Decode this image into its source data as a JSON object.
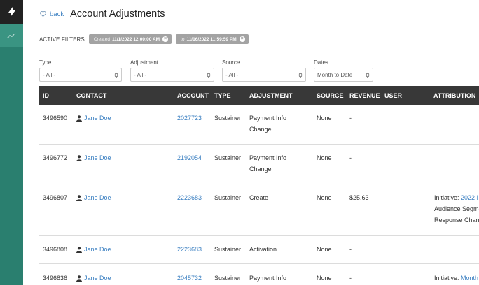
{
  "header": {
    "back_label": "back",
    "title": "Account Adjustments"
  },
  "filters": {
    "label": "ACTIVE FILTERS",
    "chips": [
      {
        "key": "Created",
        "value": "11/1/2022 12:00:00 AM"
      },
      {
        "key": "to",
        "value": "11/16/2022 11:59:59 PM"
      }
    ]
  },
  "selects": {
    "type": {
      "label": "Type",
      "value": "- All -"
    },
    "adjustment": {
      "label": "Adjustment",
      "value": "- All -"
    },
    "source": {
      "label": "Source",
      "value": "- All -"
    },
    "dates": {
      "label": "Dates",
      "value": "Month to Date"
    }
  },
  "table": {
    "columns": [
      "ID",
      "CONTACT",
      "ACCOUNT",
      "TYPE",
      "ADJUSTMENT",
      "SOURCE",
      "REVENUE",
      "USER",
      "ATTRIBUTION"
    ],
    "rows": [
      {
        "id": "3496590",
        "contact": "Jane Doe",
        "account": "2027723",
        "type": "Sustainer",
        "adjustment_1": "Payment Info",
        "adjustment_2": "Change",
        "source": "None",
        "revenue": "-",
        "user": "",
        "attr_1_label": "",
        "attr_1_link": "",
        "attr_2": "",
        "attr_3": ""
      },
      {
        "id": "3496772",
        "contact": "Jane Doe",
        "account": "2192054",
        "type": "Sustainer",
        "adjustment_1": "Payment Info",
        "adjustment_2": "Change",
        "source": "None",
        "revenue": "-",
        "user": "",
        "attr_1_label": "",
        "attr_1_link": "",
        "attr_2": "",
        "attr_3": ""
      },
      {
        "id": "3496807",
        "contact": "Jane Doe",
        "account": "2223683",
        "type": "Sustainer",
        "adjustment_1": "Create",
        "adjustment_2": "",
        "source": "None",
        "revenue": "$25.63",
        "user": "",
        "attr_1_label": "Initiative: ",
        "attr_1_link": "2022 I",
        "attr_2": "Audience Segme",
        "attr_3": "Response Chan"
      },
      {
        "id": "3496808",
        "contact": "Jane Doe",
        "account": "2223683",
        "type": "Sustainer",
        "adjustment_1": "Activation",
        "adjustment_2": "",
        "source": "None",
        "revenue": "-",
        "user": "",
        "attr_1_label": "",
        "attr_1_link": "",
        "attr_2": "",
        "attr_3": ""
      },
      {
        "id": "3496836",
        "contact": "Jane Doe",
        "account": "2045732",
        "type": "Sustainer",
        "adjustment_1": "Payment Info",
        "adjustment_2": "",
        "source": "None",
        "revenue": "-",
        "user": "",
        "attr_1_label": "Initiative: ",
        "attr_1_link": "Month",
        "attr_2": "",
        "attr_3": ""
      }
    ]
  },
  "colors": {
    "rail": "#2a7f6f",
    "rail_active": "#3a9482",
    "link": "#3a7fc1",
    "table_header": "#383838",
    "chip": "#a3a3a3"
  }
}
